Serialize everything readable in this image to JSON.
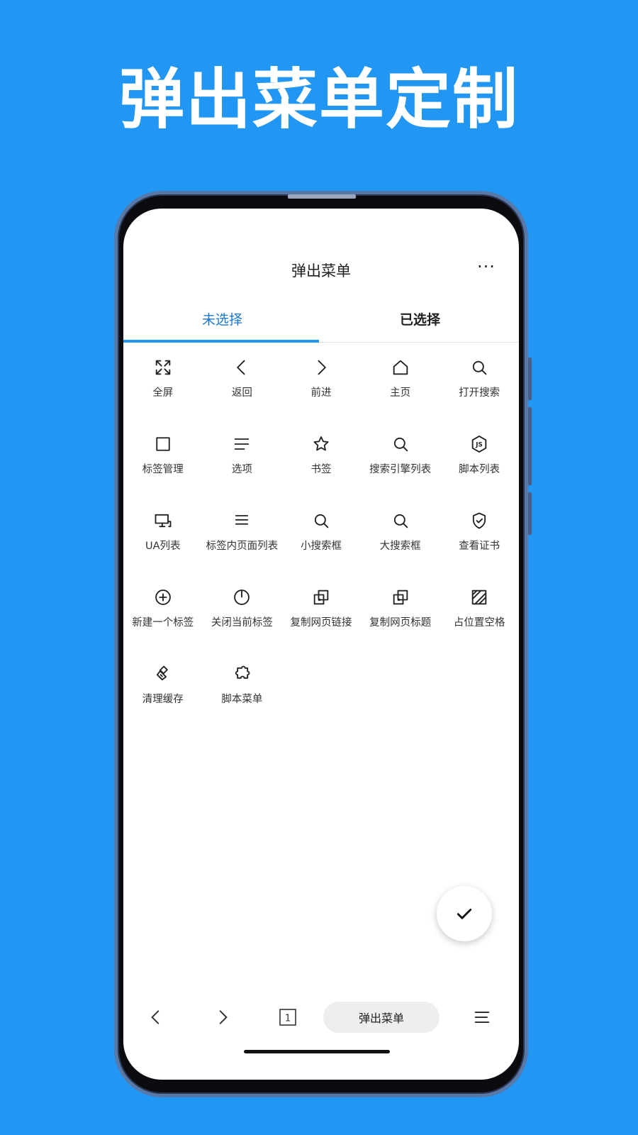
{
  "promo": {
    "title": "弹出菜单定制"
  },
  "header": {
    "title": "弹出菜单",
    "more_label": "···"
  },
  "tabs": [
    {
      "label": "未选择",
      "active": true
    },
    {
      "label": "已选择",
      "active": false
    }
  ],
  "grid_items": [
    {
      "label": "全屏",
      "icon": "fullscreen-icon"
    },
    {
      "label": "返回",
      "icon": "chevron-left-icon"
    },
    {
      "label": "前进",
      "icon": "chevron-right-icon"
    },
    {
      "label": "主页",
      "icon": "home-icon"
    },
    {
      "label": "打开搜索",
      "icon": "search-icon"
    },
    {
      "label": "标签管理",
      "icon": "square-icon"
    },
    {
      "label": "选项",
      "icon": "lines-icon"
    },
    {
      "label": "书签",
      "icon": "star-icon"
    },
    {
      "label": "搜索引擎列表",
      "icon": "search-icon"
    },
    {
      "label": "脚本列表",
      "icon": "js-icon"
    },
    {
      "label": "UA列表",
      "icon": "monitor-icon"
    },
    {
      "label": "标签内页面列表",
      "icon": "list-icon"
    },
    {
      "label": "小搜索框",
      "icon": "search-icon"
    },
    {
      "label": "大搜索框",
      "icon": "search-icon"
    },
    {
      "label": "查看证书",
      "icon": "shield-check-icon"
    },
    {
      "label": "新建一个标签",
      "icon": "plus-circle-icon"
    },
    {
      "label": "关闭当前标签",
      "icon": "power-icon"
    },
    {
      "label": "复制网页链接",
      "icon": "copy-icon"
    },
    {
      "label": "复制网页标题",
      "icon": "copy-icon"
    },
    {
      "label": "占位置空格",
      "icon": "placeholder-icon"
    },
    {
      "label": "清理缓存",
      "icon": "brush-icon"
    },
    {
      "label": "脚本菜单",
      "icon": "puzzle-icon"
    }
  ],
  "fab": {
    "icon": "check-icon"
  },
  "bottom_bar": {
    "tab_count": "1",
    "menu_label": "弹出菜单"
  },
  "colors": {
    "background": "#2196F3",
    "accent": "#1976D2"
  }
}
